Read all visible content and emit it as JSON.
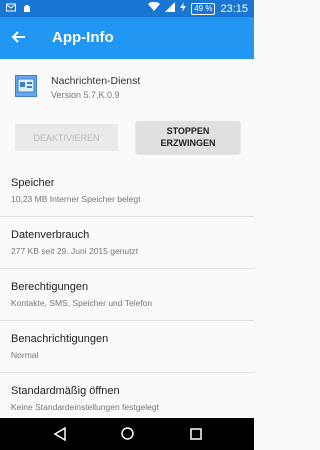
{
  "status_bar": {
    "battery": "49 %",
    "time": "23:15"
  },
  "app_bar": {
    "title": "App-Info"
  },
  "app": {
    "name": "Nachrichten-Dienst",
    "version": "Version 5.7.K.0.9"
  },
  "buttons": {
    "disable_label": "DEAKTIVIEREN",
    "force_stop_line1": "STOPPEN",
    "force_stop_line2": "ERZWINGEN"
  },
  "items": [
    {
      "title": "Speicher",
      "summary": "10,23 MB Interner Speicher belegt"
    },
    {
      "title": "Datenverbrauch",
      "summary": "277 KB seit 29. Juni 2015 genutzt"
    },
    {
      "title": "Berechtigungen",
      "summary": "Kontakte, SMS, Speicher und Telefon"
    },
    {
      "title": "Benachrichtigungen",
      "summary": "Normal"
    },
    {
      "title": "Standardmäßig öffnen",
      "summary": "Keine Standardeinstellungen festgelegt"
    }
  ],
  "colors": {
    "status_bar": "#1976d2",
    "app_bar": "#2196f3"
  }
}
